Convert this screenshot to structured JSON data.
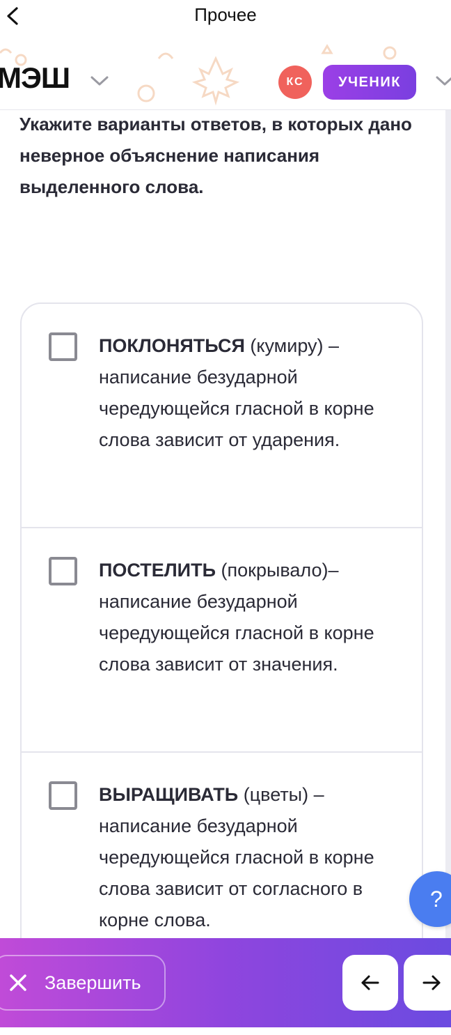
{
  "topnav": {
    "title": "Прочее"
  },
  "header": {
    "logo": "МЭШ",
    "avatar_initials": "КС",
    "role": "УЧЕНИК"
  },
  "question": {
    "text": "Укажите варианты ответов, в которых дано неверное объяснение написания выделенного слова."
  },
  "options": [
    {
      "word": "ПОКЛОНЯТЬСЯ",
      "rest": " (кумиру) – написание безударной чередующейся гласной в корне слова зависит от ударения.",
      "checked": false
    },
    {
      "word": "ПОСТЕЛИТЬ",
      "rest": " (покрывало)– написание безударной чередующейся гласной в корне слова зависит от значения.",
      "checked": false
    },
    {
      "word": "ВЫРАЩИВАТЬ",
      "rest": " (цветы) – написание безударной чередующейся гласной в корне слова зависит от согласного в корне слова.",
      "checked": false
    }
  ],
  "help": {
    "label": "?"
  },
  "bottom": {
    "finish_label": "Завершить"
  },
  "colors": {
    "accent": "#8f45de",
    "avatar": "#f0625c",
    "help": "#4a7df0"
  }
}
